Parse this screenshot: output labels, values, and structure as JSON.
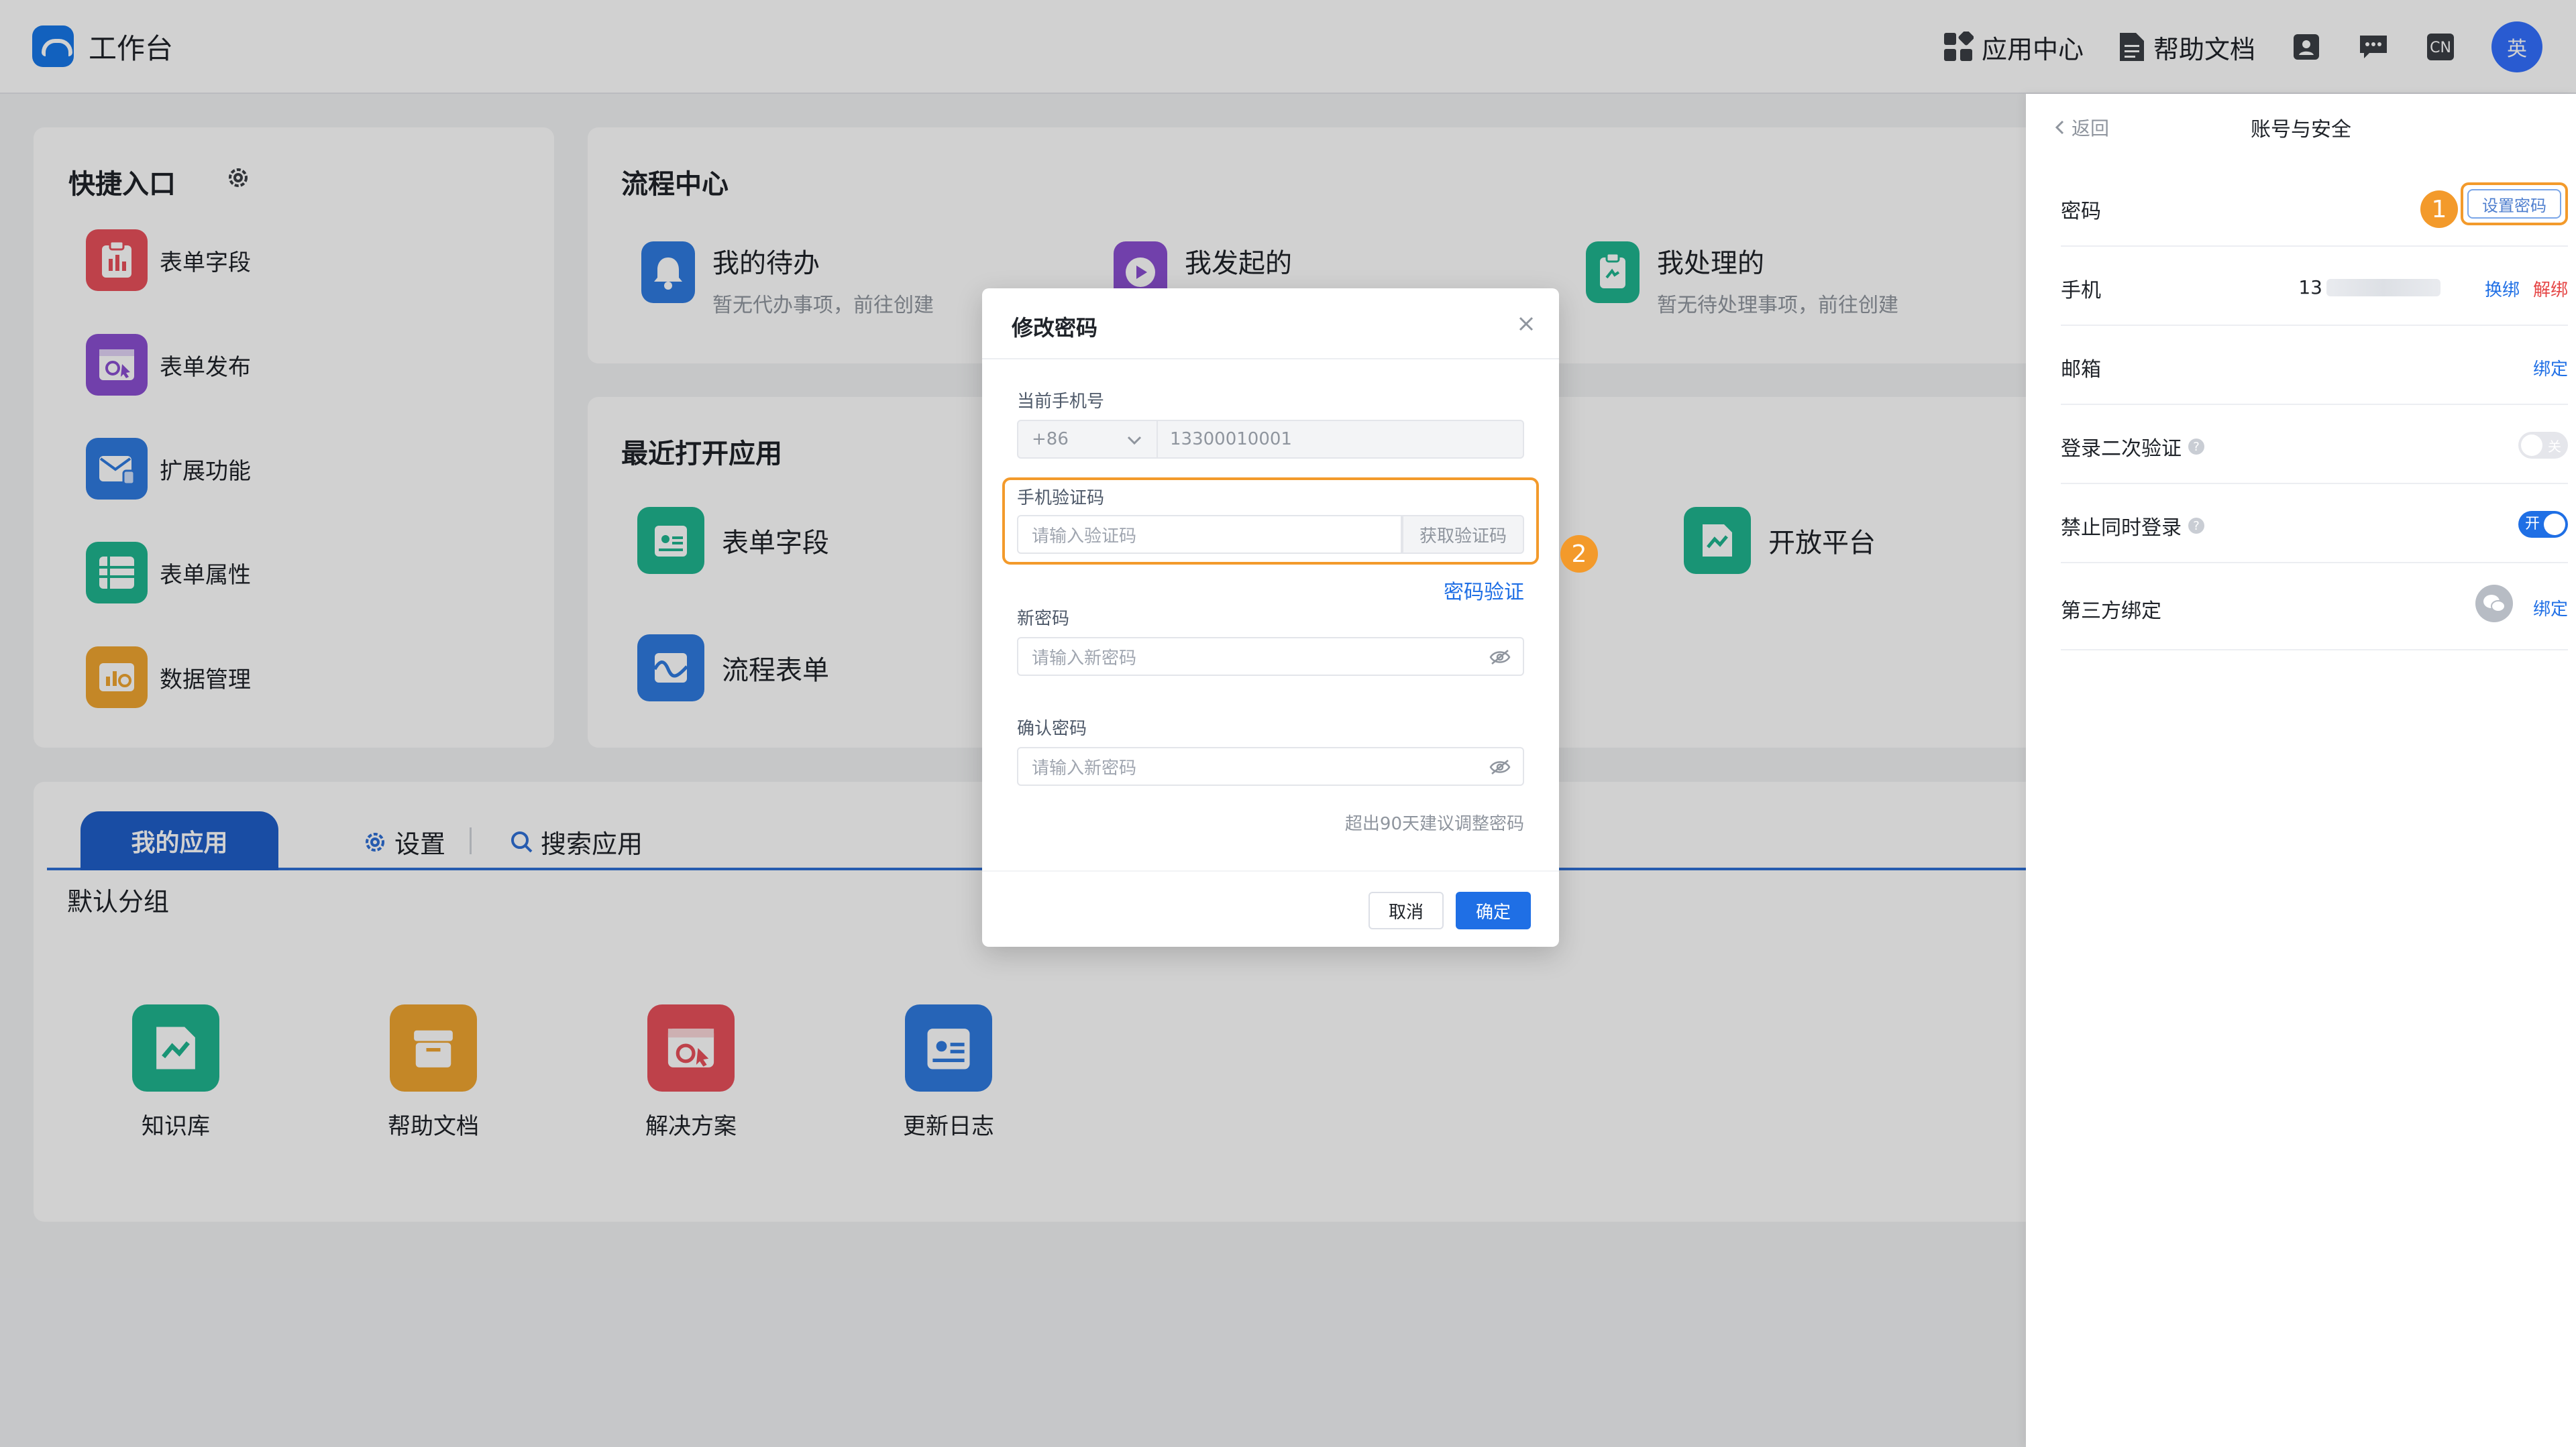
{
  "app": {
    "title": "工作台"
  },
  "top_nav": {
    "app_center": "应用中心",
    "help_docs": "帮助文档",
    "lang": "CN",
    "avatar": "英"
  },
  "quick_entry": {
    "title": "快捷入口",
    "items": [
      {
        "label": "表单字段",
        "color": "#e8505b"
      },
      {
        "label": "表单发布",
        "color": "#8a4fd1"
      },
      {
        "label": "扩展功能",
        "color": "#2f7be0"
      },
      {
        "label": "表单属性",
        "color": "#1fb58f"
      },
      {
        "label": "数据管理",
        "color": "#f0a530"
      }
    ]
  },
  "flow_center": {
    "title": "流程中心",
    "items": [
      {
        "label": "我的待办",
        "sub": "暂无代办事项，前往创建",
        "color": "#2f7be0"
      },
      {
        "label": "我发起的",
        "sub": "",
        "color": "#8a4fd1"
      },
      {
        "label": "我处理的",
        "sub": "暂无待处理事项，前往创建",
        "color": "#1fb58f"
      }
    ]
  },
  "recent_apps": {
    "title": "最近打开应用",
    "items": [
      {
        "label": "表单字段",
        "color": "#1fb58f"
      },
      {
        "label": "流程表单",
        "color": "#2f7be0"
      },
      {
        "label": "开放平台",
        "color": "#1fb58f"
      }
    ]
  },
  "my_apps": {
    "tab_active": "我的应用",
    "tab_settings": "设置",
    "tab_search": "搜索应用",
    "group": "默认分组",
    "items": [
      {
        "label": "知识库",
        "color": "#1fb58f"
      },
      {
        "label": "帮助文档",
        "color": "#f0a530"
      },
      {
        "label": "解决方案",
        "color": "#e8505b"
      },
      {
        "label": "更新日志",
        "color": "#2f7be0"
      }
    ]
  },
  "account_panel": {
    "back": "返回",
    "title": "账号与安全",
    "password_label": "密码",
    "set_password": "设置密码",
    "phone_label": "手机",
    "phone_prefix": "13",
    "change": "换绑",
    "unbind": "解绑",
    "email_label": "邮箱",
    "bind": "绑定",
    "two_factor_label": "登录二次验证",
    "two_factor_state": "关",
    "no_concurrent_label": "禁止同时登录",
    "no_concurrent_state": "开",
    "third_party_label": "第三方绑定",
    "third_party_bind": "绑定",
    "step1": "1"
  },
  "modal": {
    "title": "修改密码",
    "current_phone_label": "当前手机号",
    "country_code": "+86",
    "current_phone": "13300010001",
    "code_label": "手机验证码",
    "code_placeholder": "请输入验证码",
    "get_code": "获取验证码",
    "password_verify": "密码验证",
    "new_pwd_label": "新密码",
    "new_pwd_placeholder": "请输入新密码",
    "confirm_pwd_label": "确认密码",
    "confirm_pwd_placeholder": "请输入新密码",
    "hint": "超出90天建议调整密码",
    "cancel": "取消",
    "ok": "确定",
    "step2": "2"
  }
}
